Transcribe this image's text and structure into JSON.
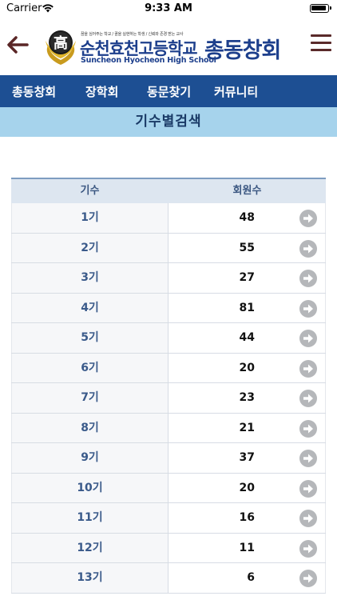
{
  "status_bar": {
    "carrier": "Carrier",
    "time": "9:33 AM"
  },
  "header": {
    "logo_motto": "꿈을 심어주는 학교 / 꿈을 실현하는 학생 / 신뢰와 존경 받는 교사",
    "logo_school_ko": "순천효천고등학교",
    "logo_school_en": "Suncheon Hyocheon High School",
    "title": "총동창회",
    "emblem_char": "高"
  },
  "nav": {
    "items": [
      {
        "label": "총동창회"
      },
      {
        "label": "장학회"
      },
      {
        "label": "동문찾기"
      },
      {
        "label": "커뮤니티"
      }
    ]
  },
  "section_title": "기수별검색",
  "table": {
    "headers": {
      "generation": "기수",
      "members": "회원수"
    },
    "rows": [
      {
        "generation": "1기",
        "members": "48"
      },
      {
        "generation": "2기",
        "members": "55"
      },
      {
        "generation": "3기",
        "members": "27"
      },
      {
        "generation": "4기",
        "members": "81"
      },
      {
        "generation": "5기",
        "members": "44"
      },
      {
        "generation": "6기",
        "members": "20"
      },
      {
        "generation": "7기",
        "members": "23"
      },
      {
        "generation": "8기",
        "members": "21"
      },
      {
        "generation": "9기",
        "members": "37"
      },
      {
        "generation": "10기",
        "members": "20"
      },
      {
        "generation": "11기",
        "members": "16"
      },
      {
        "generation": "12기",
        "members": "11"
      },
      {
        "generation": "13기",
        "members": "6"
      }
    ]
  },
  "colors": {
    "brand_blue": "#1d4f93",
    "title_blue": "#1d3f8c",
    "section_bg": "#a6d3ec",
    "arrow_gray": "#b5b7ba"
  },
  "icons": {
    "back": "left-arrow-icon",
    "menu": "hamburger-menu-icon",
    "row_go": "right-arrow-circle-icon"
  }
}
